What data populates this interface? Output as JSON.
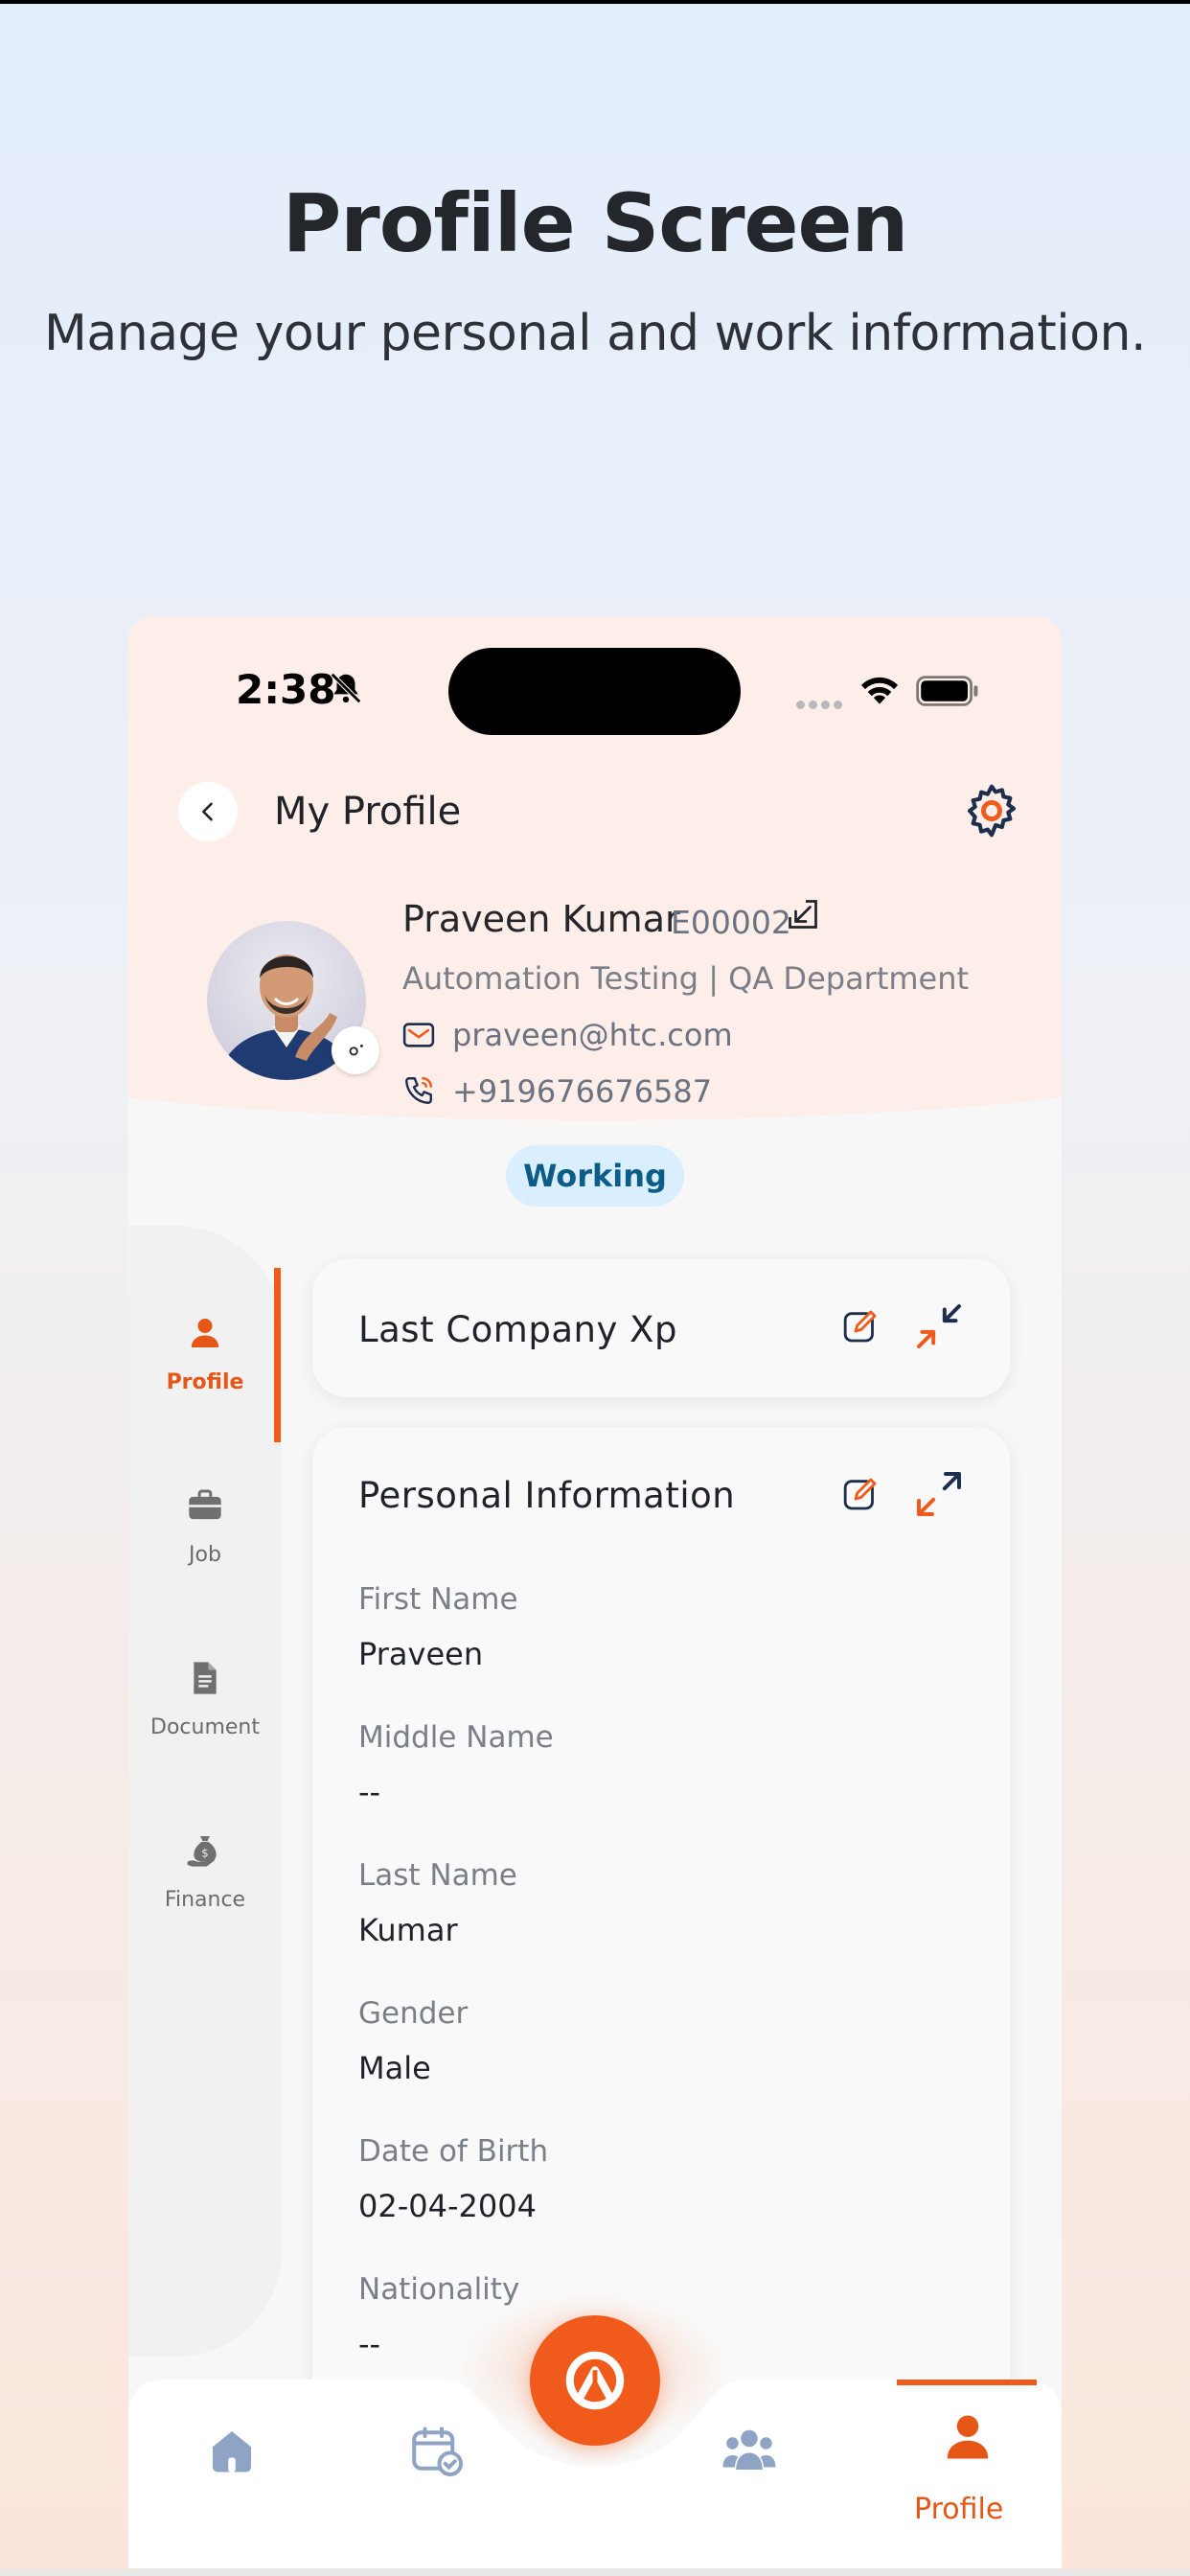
{
  "hero": {
    "title": "Profile Screen",
    "subtitle": "Manage your personal and work information."
  },
  "status_bar": {
    "time": "2:38",
    "icons": [
      "bell-slash-icon",
      "signal-dots-icon",
      "wifi-icon",
      "battery-icon"
    ]
  },
  "header": {
    "title": "My Profile",
    "back_icon": "chevron-left-icon",
    "settings_icon": "gear-icon"
  },
  "profile": {
    "name": "Praveen Kumar",
    "employee_id": "E00002",
    "designation": "Automation Testing | QA Department",
    "email": "praveen@htc.com",
    "phone": "+919676676587",
    "status": "Working"
  },
  "side_nav": {
    "items": [
      {
        "label": "Profile",
        "icon": "person-icon",
        "active": true
      },
      {
        "label": "Job",
        "icon": "briefcase-icon",
        "active": false
      },
      {
        "label": "Document",
        "icon": "document-icon",
        "active": false
      },
      {
        "label": "Finance",
        "icon": "money-bag-icon",
        "active": false
      }
    ]
  },
  "cards": {
    "last_company": {
      "title": "Last Company Xp",
      "state": "collapsed"
    },
    "personal_info": {
      "title": "Personal Information",
      "state": "expanded",
      "fields": [
        {
          "label": "First Name",
          "value": "Praveen"
        },
        {
          "label": "Middle Name",
          "value": "--"
        },
        {
          "label": "Last Name",
          "value": "Kumar"
        },
        {
          "label": "Gender",
          "value": "Male"
        },
        {
          "label": "Date of Birth",
          "value": "02-04-2004"
        },
        {
          "label": "Nationality",
          "value": "--"
        }
      ]
    }
  },
  "bottom_nav": {
    "items": [
      {
        "icon": "home-icon"
      },
      {
        "icon": "calendar-check-icon"
      },
      {
        "icon": "team-icon"
      },
      {
        "icon": "person-icon",
        "label": "Profile",
        "active": true
      }
    ],
    "fab_icon": "app-logo-icon"
  },
  "colors": {
    "accent": "#f05a1a",
    "header_bg": "#fdeee9",
    "status_badge_bg": "#d9efff",
    "status_badge_text": "#0d5b87",
    "icon_navy": "#1e2f4d",
    "nav_inactive": "#8fa3c4"
  }
}
